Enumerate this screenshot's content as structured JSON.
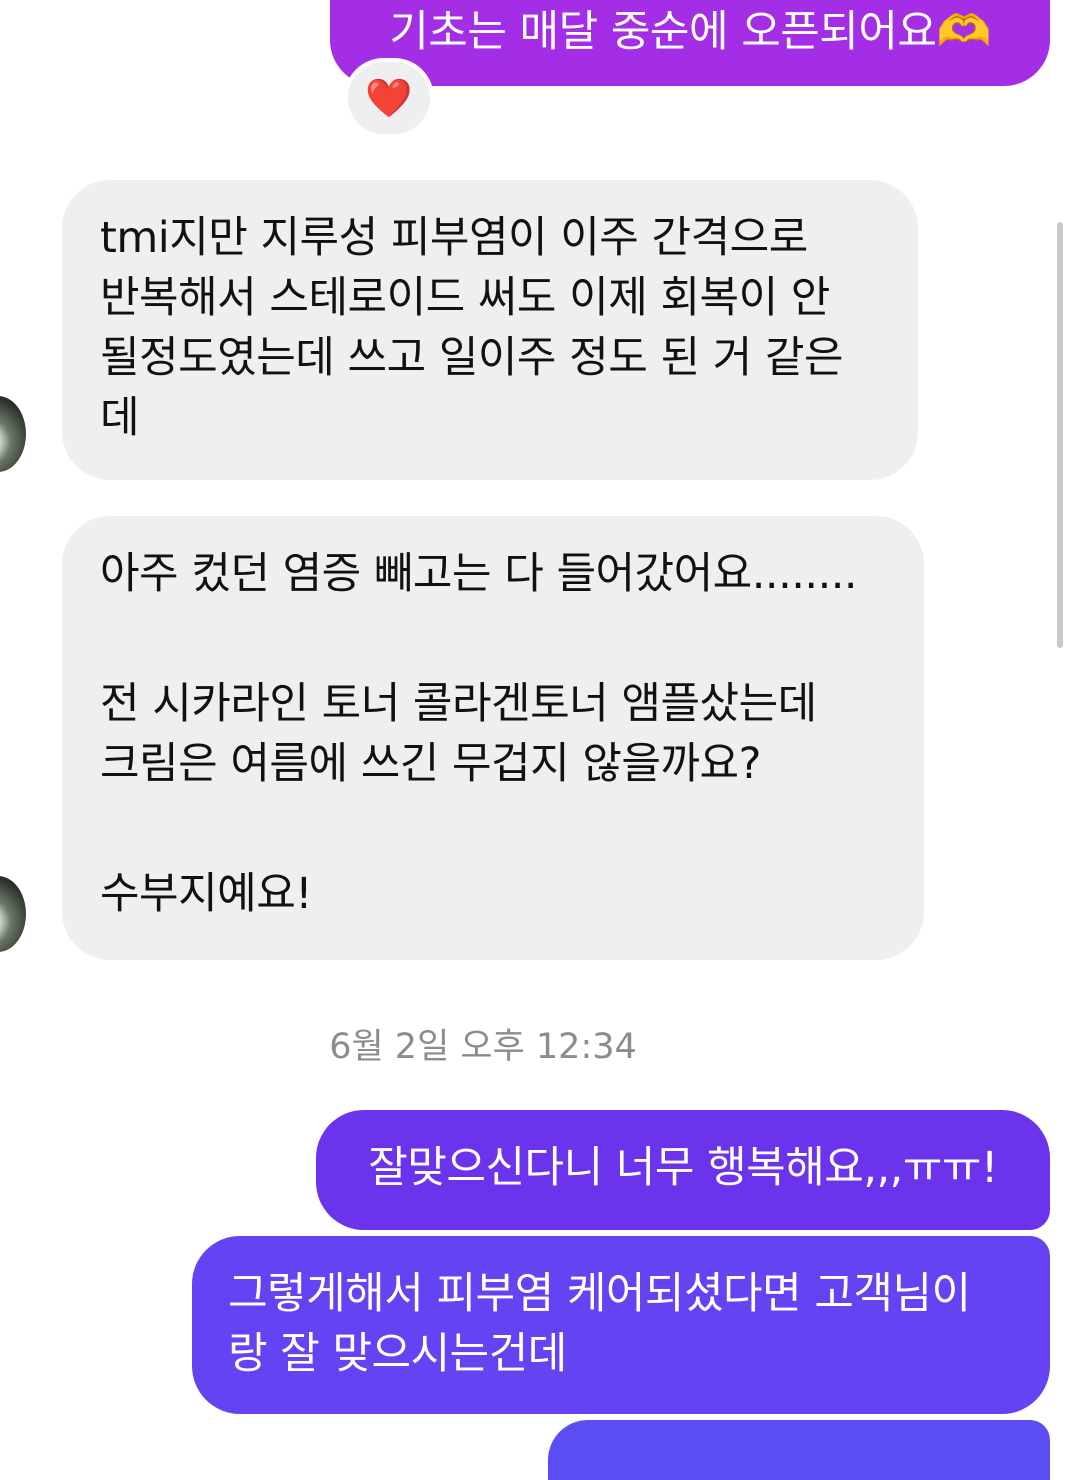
{
  "messages": {
    "m1": {
      "text": "기초는 매달 중순에 오픈되어요",
      "emoji": "🫶"
    },
    "m1_reaction": "❤️",
    "m2": {
      "line1": "tmi지만 지루성 피부염이 이주 간격으로",
      "line2": "반복해서 스테로이드 써도 이제 회복이 안",
      "line3": "될정도였는데 쓰고 일이주 정도 된 거 같은",
      "line4": "데"
    },
    "m3": {
      "p1": "아주 컸던 염증 빼고는 다 들어갔어요........",
      "p2_line1": "전 시카라인 토너 콜라겐토너 앰플샀는데",
      "p2_line2": "크림은 여름에 쓰긴 무겁지 않을까요?",
      "p3": "수부지예요!"
    },
    "timestamp": "6월 2일 오후 12:34",
    "m4": {
      "text": "잘맞으신다니 너무 행복해요,,,ㅠㅠ!"
    },
    "m5": {
      "line1": "그렇게해서 피부염 케어되셨다면 고객님이",
      "line2": "랑 잘 맞으시는건데"
    }
  },
  "colors": {
    "outgoing_top": "#a32ee6",
    "outgoing_mid": "#6b33ec",
    "outgoing_bottom": "#6542f2",
    "incoming": "#efeff2",
    "timestamp_text": "#8b8b90"
  },
  "icons": {
    "reaction": "heart-icon",
    "emoji": "heart-hands-icon"
  }
}
